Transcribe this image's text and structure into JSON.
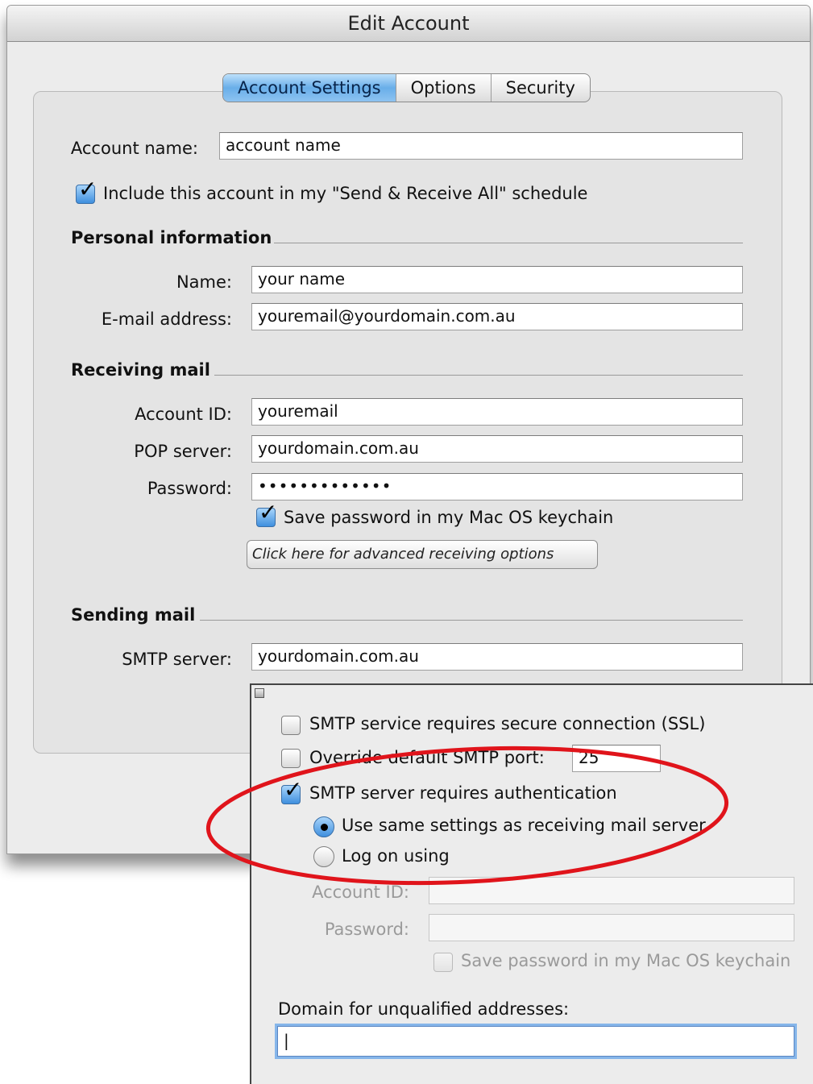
{
  "window": {
    "title": "Edit Account"
  },
  "tabs": [
    {
      "label": "Account Settings",
      "active": true
    },
    {
      "label": "Options",
      "active": false
    },
    {
      "label": "Security",
      "active": false
    }
  ],
  "account": {
    "name_label": "Account name:",
    "name_value": "account name",
    "include_label": "Include this account in my \"Send & Receive All\" schedule",
    "include_checked": true
  },
  "personal": {
    "heading": "Personal information",
    "name_label": "Name:",
    "name_value": "your name",
    "email_label": "E-mail address:",
    "email_value": "youremail@yourdomain.com.au"
  },
  "receiving": {
    "heading": "Receiving mail",
    "account_id_label": "Account ID:",
    "account_id_value": "youremail",
    "pop_label": "POP server:",
    "pop_value": "yourdomain.com.au",
    "password_label": "Password:",
    "password_value": "•••••••••••••",
    "save_pw_label": "Save password in my Mac OS keychain",
    "save_pw_checked": true,
    "advanced_button": "Click here for advanced receiving options"
  },
  "sending": {
    "heading": "Sending mail",
    "smtp_label": "SMTP server:",
    "smtp_value": "yourdomain.com.au"
  },
  "smtp_options": {
    "ssl_label": "SMTP service requires secure connection (SSL)",
    "ssl_checked": false,
    "override_port_label": "Override default SMTP port:",
    "override_checked": false,
    "port_value": "25",
    "auth_label": "SMTP server requires authentication",
    "auth_checked": true,
    "use_same_label": "Use same settings as receiving mail server",
    "use_same_selected": true,
    "log_on_label": "Log on using",
    "log_on_selected": false,
    "logon_account_id_label": "Account ID:",
    "logon_password_label": "Password:",
    "logon_save_pw_label": "Save password in my Mac OS keychain",
    "domain_label": "Domain for unqualified addresses:",
    "domain_value": "|"
  },
  "colors": {
    "annotation": "#e0141b",
    "tab_active": "#69aee9",
    "checkbox_checked": "#3f8fde"
  }
}
